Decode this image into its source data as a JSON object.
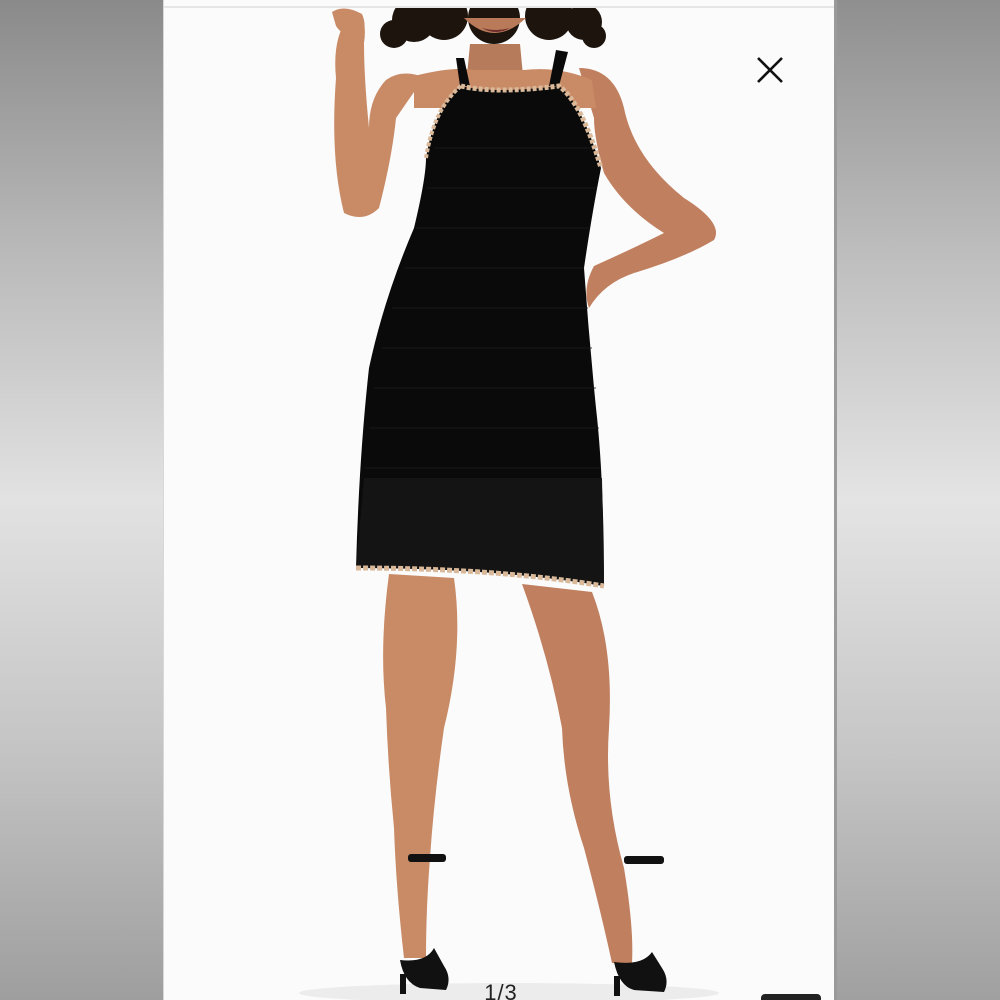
{
  "viewer": {
    "close_icon": "close-icon",
    "counter": "1/3",
    "image": {
      "subject": "product-photo",
      "dress_color": "#0a0a0a",
      "trim_color": "#d9b99a",
      "skin_color": "#c98a66",
      "hair_color": "#1d140e"
    }
  }
}
